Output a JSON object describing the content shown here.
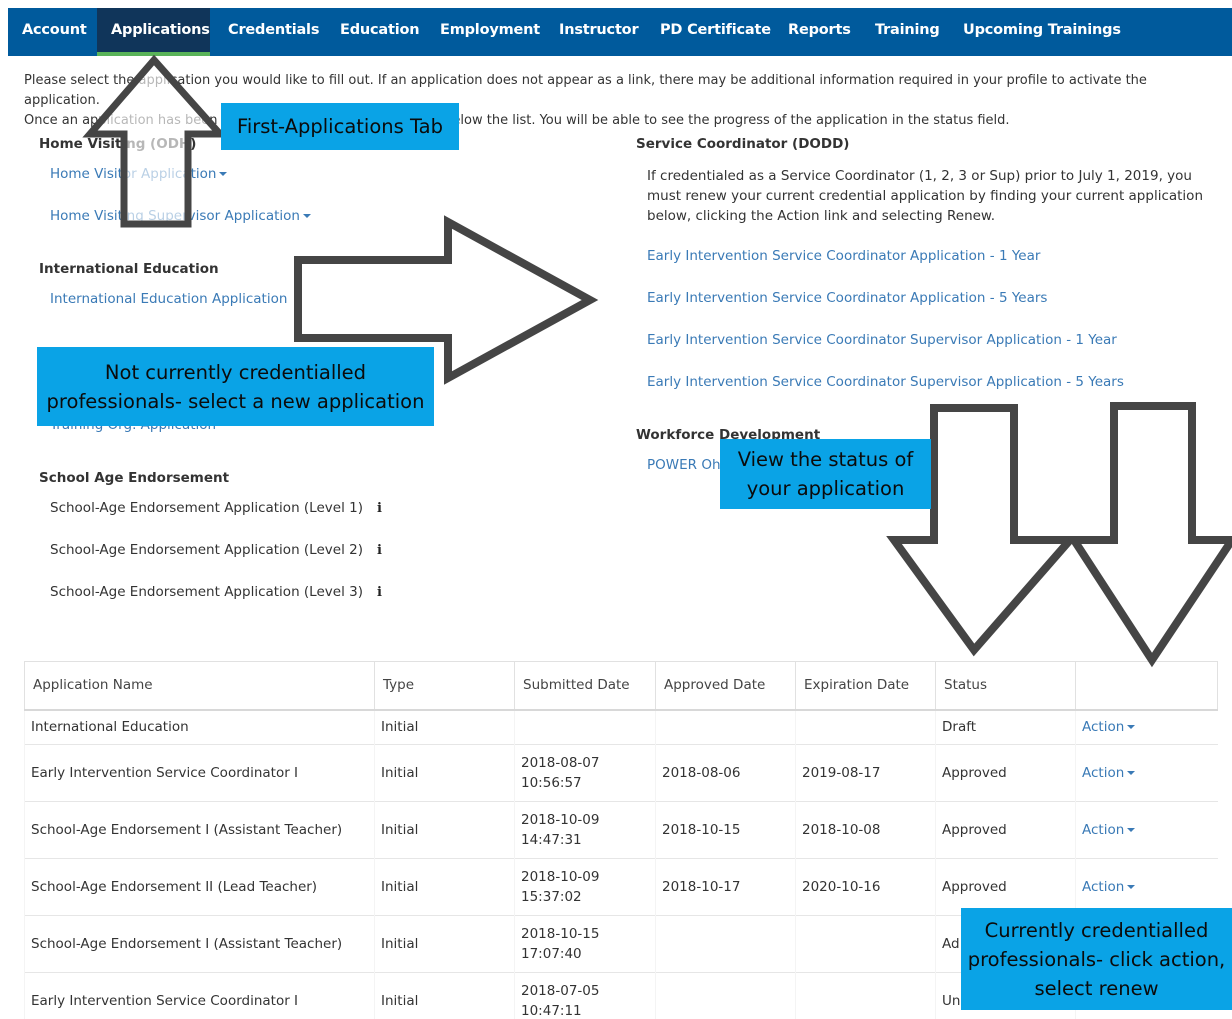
{
  "nav": {
    "tabs": [
      "Account",
      "Applications",
      "Credentials",
      "Education",
      "Employment",
      "Instructor",
      "PD Certificate",
      "Reports",
      "Training",
      "Upcoming Trainings"
    ],
    "active": "Applications"
  },
  "intro": {
    "line1": "Please select the application you would like to fill out. If an application does not appear as a link, there may be additional information required in your profile to activate the application.",
    "line2": "Once an application has been started, it will appear in the chart below the list. You will be able to see the progress of the application in the status field."
  },
  "home_visiting": {
    "heading": "Home Visiting (ODH)",
    "links": [
      "Home Visitor Application",
      "Home Visiting Supervisor Application"
    ]
  },
  "international": {
    "heading": "International Education",
    "link": "International Education Application"
  },
  "training_org": {
    "link": "Training Org. Application"
  },
  "school_age": {
    "heading": "School Age Endorsement",
    "items": [
      "School-Age Endorsement Application (Level 1)",
      "School-Age Endorsement Application (Level 2)",
      "School-Age Endorsement Application (Level 3)"
    ],
    "info_glyph": "i"
  },
  "service_coord": {
    "heading": "Service Coordinator (DODD)",
    "note_lines": [
      "If credentialed as a Service Coordinator (1, 2, 3 or Sup) prior to July 1, 2019, you",
      "must renew your current credential application by finding your current application",
      "below, clicking the Action link and selecting Renew."
    ],
    "links": [
      "Early Intervention Service Coordinator Application - 1 Year",
      "Early Intervention Service Coordinator Application - 5 Years",
      "Early Intervention Service Coordinator Supervisor Application - 1 Year",
      "Early Intervention Service Coordinator Supervisor Application - 5 Years"
    ]
  },
  "workforce": {
    "heading": "Workforce Development",
    "link": "POWER Ohio"
  },
  "table": {
    "headers": [
      "Application Name",
      "Type",
      "Submitted Date",
      "Approved Date",
      "Expiration Date",
      "Status",
      ""
    ],
    "rows": [
      {
        "name": "International Education",
        "type": "Initial",
        "submitted_date": "",
        "submitted_time": "",
        "approved": "",
        "expiration": "",
        "status": "Draft",
        "action": "Action"
      },
      {
        "name": "Early Intervention Service Coordinator I",
        "type": "Initial",
        "submitted_date": "2018-08-07",
        "submitted_time": "10:56:57",
        "approved": "2018-08-06",
        "expiration": "2019-08-17",
        "status": "Approved",
        "action": "Action"
      },
      {
        "name": "School-Age Endorsement I (Assistant Teacher)",
        "type": "Initial",
        "submitted_date": "2018-10-09",
        "submitted_time": "14:47:31",
        "approved": "2018-10-15",
        "expiration": "2018-10-08",
        "status": "Approved",
        "action": "Action"
      },
      {
        "name": "School-Age Endorsement II (Lead Teacher)",
        "type": "Initial",
        "submitted_date": "2018-10-09",
        "submitted_time": "15:37:02",
        "approved": "2018-10-17",
        "expiration": "2020-10-16",
        "status": "Approved",
        "action": "Action"
      },
      {
        "name": "School-Age Endorsement I (Assistant Teacher)",
        "type": "Initial",
        "submitted_date": "2018-10-15",
        "submitted_time": "17:07:40",
        "approved": "",
        "expiration": "",
        "status": "Ad",
        "action": ""
      },
      {
        "name": "Early Intervention Service Coordinator I",
        "type": "Initial",
        "submitted_date": "2018-07-05",
        "submitted_time": "10:47:11",
        "approved": "",
        "expiration": "",
        "status": "Un",
        "action": ""
      }
    ]
  },
  "callouts": {
    "first_tab": "First-Applications Tab",
    "not_credentialled_1": "Not currently credentialled",
    "not_credentialled_2": "professionals- select a new application",
    "view_status_1": "View the status of",
    "view_status_2": "your application",
    "currently_1": "Currently credentialled",
    "currently_2": "professionals- click action,",
    "currently_3": "select renew"
  },
  "colors": {
    "nav_bg": "#005a9c",
    "nav_active_bg": "#10355a",
    "nav_active_underline": "#59b359",
    "link": "#3a7ab6",
    "callout_bg": "#0aa3e6",
    "arrow_stroke": "#454545"
  }
}
